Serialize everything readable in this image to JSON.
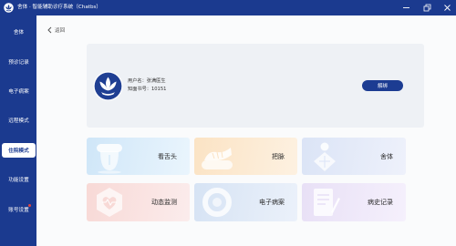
{
  "window": {
    "title": "舍体 · 智能辅助诊疗系统（Chatbs）",
    "logo_icon": "lotus-logo-icon",
    "controls": {
      "minimize_icon": "minimize-icon",
      "restore_icon": "restore-icon",
      "close_icon": "close-icon"
    }
  },
  "sidebar": {
    "items": [
      {
        "label": "舍体"
      },
      {
        "label": "预诊记录"
      },
      {
        "label": "电子病案"
      },
      {
        "label": "远程模式"
      },
      {
        "label": "住院模式",
        "active": true
      },
      {
        "label": "功能设置"
      },
      {
        "label": "账号设置",
        "badge": true
      }
    ]
  },
  "back": {
    "icon": "chevron-left-icon",
    "label": "返回"
  },
  "profile": {
    "avatar_icon": "lotus-logo-icon",
    "username": "用户名：张满医生",
    "account": "知面书号：10151",
    "unbind_label": "解绑"
  },
  "features": [
    {
      "label": "看舌头",
      "icon": "tongue-icon",
      "color_from": "#cfe6f8",
      "color_to": "#eaf5fd"
    },
    {
      "label": "把脉",
      "icon": "pulse-pillow-icon",
      "color_from": "#fbe3c4",
      "color_to": "#fdf1e1"
    },
    {
      "label": "舍体",
      "icon": "body-figure-icon",
      "color_from": "#dbe4f6",
      "color_to": "#eef1fb"
    },
    {
      "label": "动态监测",
      "icon": "heart-hexagon-icon",
      "color_from": "#f8d9d6",
      "color_to": "#fbecec"
    },
    {
      "label": "电子病案",
      "icon": "e-record-icon",
      "color_from": "#d6e3f4",
      "color_to": "#ebf1fa"
    },
    {
      "label": "病史记录",
      "icon": "document-pen-icon",
      "color_from": "#e8e0f6",
      "color_to": "#f5f0fc"
    }
  ],
  "colors": {
    "primary": "#1c3c92",
    "sidebar": "#1b3a8f",
    "badge": "#e5453b",
    "main_bg": "#fafbfc",
    "card_bg": "#eef1f5",
    "text": "#2b2b2b"
  }
}
